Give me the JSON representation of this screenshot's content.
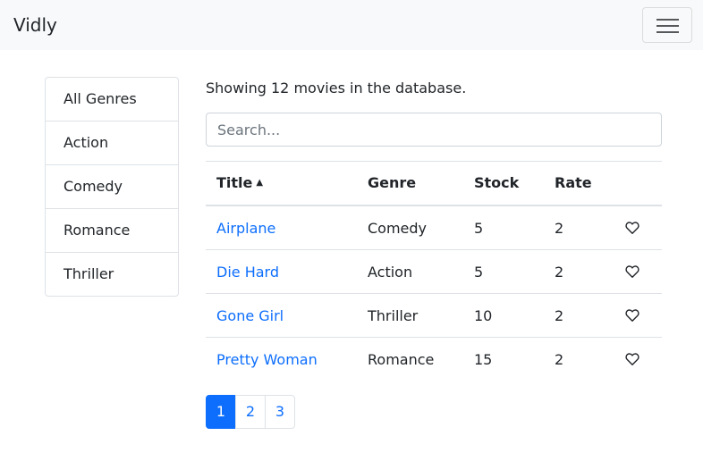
{
  "app": {
    "brand": "Vidly"
  },
  "sidebar": {
    "genres": [
      "All Genres",
      "Action",
      "Comedy",
      "Romance",
      "Thriller"
    ]
  },
  "main": {
    "count_text": "Showing 12 movies in the database.",
    "search": {
      "placeholder": "Search...",
      "value": ""
    },
    "table": {
      "columns": [
        "Title",
        "Genre",
        "Stock",
        "Rate"
      ],
      "sort_column": "Title",
      "sort_direction": "ascending",
      "rows": [
        {
          "title": "Airplane",
          "genre": "Comedy",
          "stock": "5",
          "rate": "2"
        },
        {
          "title": "Die Hard",
          "genre": "Action",
          "stock": "5",
          "rate": "2"
        },
        {
          "title": "Gone Girl",
          "genre": "Thriller",
          "stock": "10",
          "rate": "2"
        },
        {
          "title": "Pretty Woman",
          "genre": "Romance",
          "stock": "15",
          "rate": "2"
        }
      ]
    },
    "pagination": {
      "pages": [
        "1",
        "2",
        "3"
      ],
      "current": "1"
    }
  },
  "colors": {
    "accent": "#0d6efd",
    "navbar_bg": "#f8f9fa",
    "border": "#dee2e6"
  },
  "icons": {
    "hamburger": "hamburger-menu-icon",
    "like": "heart-outline-icon",
    "sort": "caret-up-icon"
  }
}
